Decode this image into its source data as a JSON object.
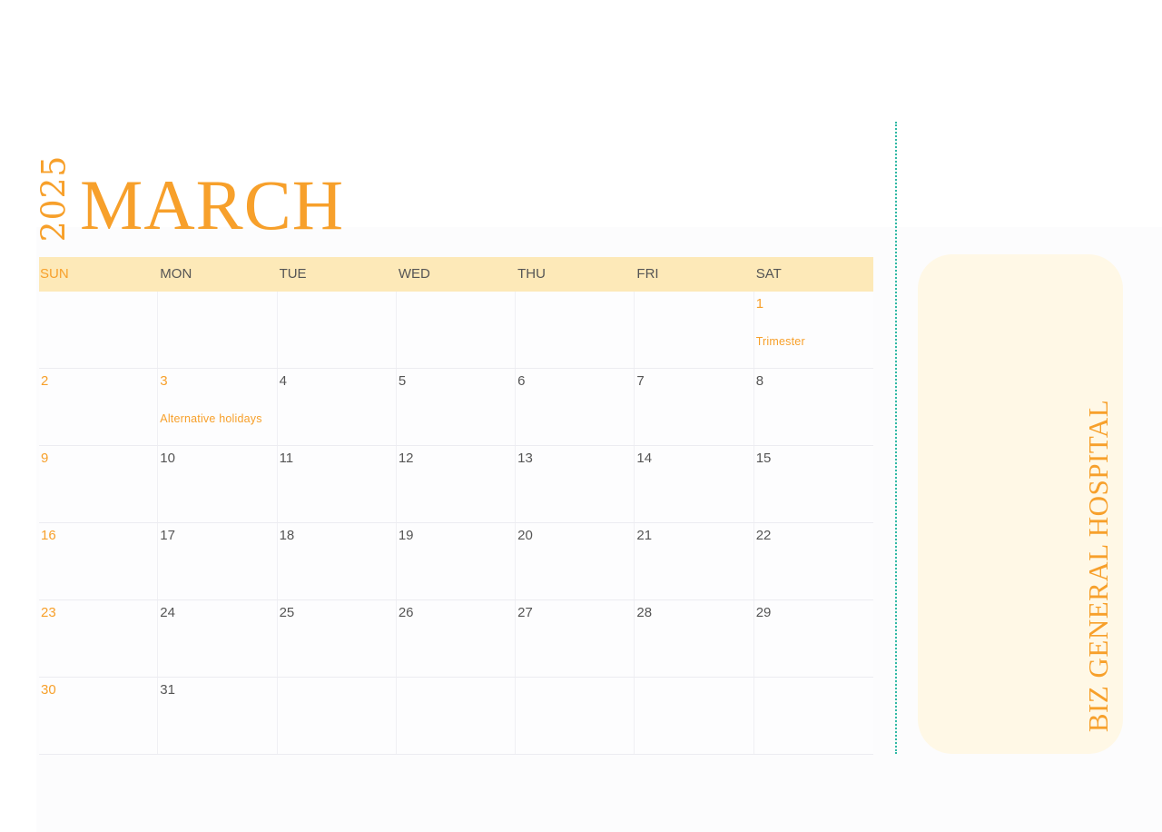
{
  "header": {
    "year": "2025",
    "month": "MARCH"
  },
  "calendar": {
    "weekdays": [
      "SUN",
      "MON",
      "TUE",
      "WED",
      "THU",
      "FRI",
      "SAT"
    ],
    "weeks": [
      [
        {
          "d": ""
        },
        {
          "d": ""
        },
        {
          "d": ""
        },
        {
          "d": ""
        },
        {
          "d": ""
        },
        {
          "d": ""
        },
        {
          "d": "1",
          "note": "Trimester",
          "hl": true
        }
      ],
      [
        {
          "d": "2"
        },
        {
          "d": "3",
          "note": "Alternative holidays",
          "hl": true
        },
        {
          "d": "4"
        },
        {
          "d": "5"
        },
        {
          "d": "6"
        },
        {
          "d": "7"
        },
        {
          "d": "8"
        }
      ],
      [
        {
          "d": "9"
        },
        {
          "d": "10"
        },
        {
          "d": "11"
        },
        {
          "d": "12"
        },
        {
          "d": "13"
        },
        {
          "d": "14"
        },
        {
          "d": "15"
        }
      ],
      [
        {
          "d": "16"
        },
        {
          "d": "17"
        },
        {
          "d": "18"
        },
        {
          "d": "19"
        },
        {
          "d": "20"
        },
        {
          "d": "21"
        },
        {
          "d": "22"
        }
      ],
      [
        {
          "d": "23"
        },
        {
          "d": "24"
        },
        {
          "d": "25"
        },
        {
          "d": "26"
        },
        {
          "d": "27"
        },
        {
          "d": "28"
        },
        {
          "d": "29"
        }
      ],
      [
        {
          "d": "30"
        },
        {
          "d": "31"
        },
        {
          "d": ""
        },
        {
          "d": ""
        },
        {
          "d": ""
        },
        {
          "d": ""
        },
        {
          "d": ""
        }
      ]
    ]
  },
  "side": {
    "organization": "BIZ GENERAL HOSPITAL"
  },
  "colors": {
    "accent": "#f7a02b",
    "header_band": "#fde9b8",
    "side_panel": "#fff8e6",
    "divider": "#30b8a4"
  }
}
